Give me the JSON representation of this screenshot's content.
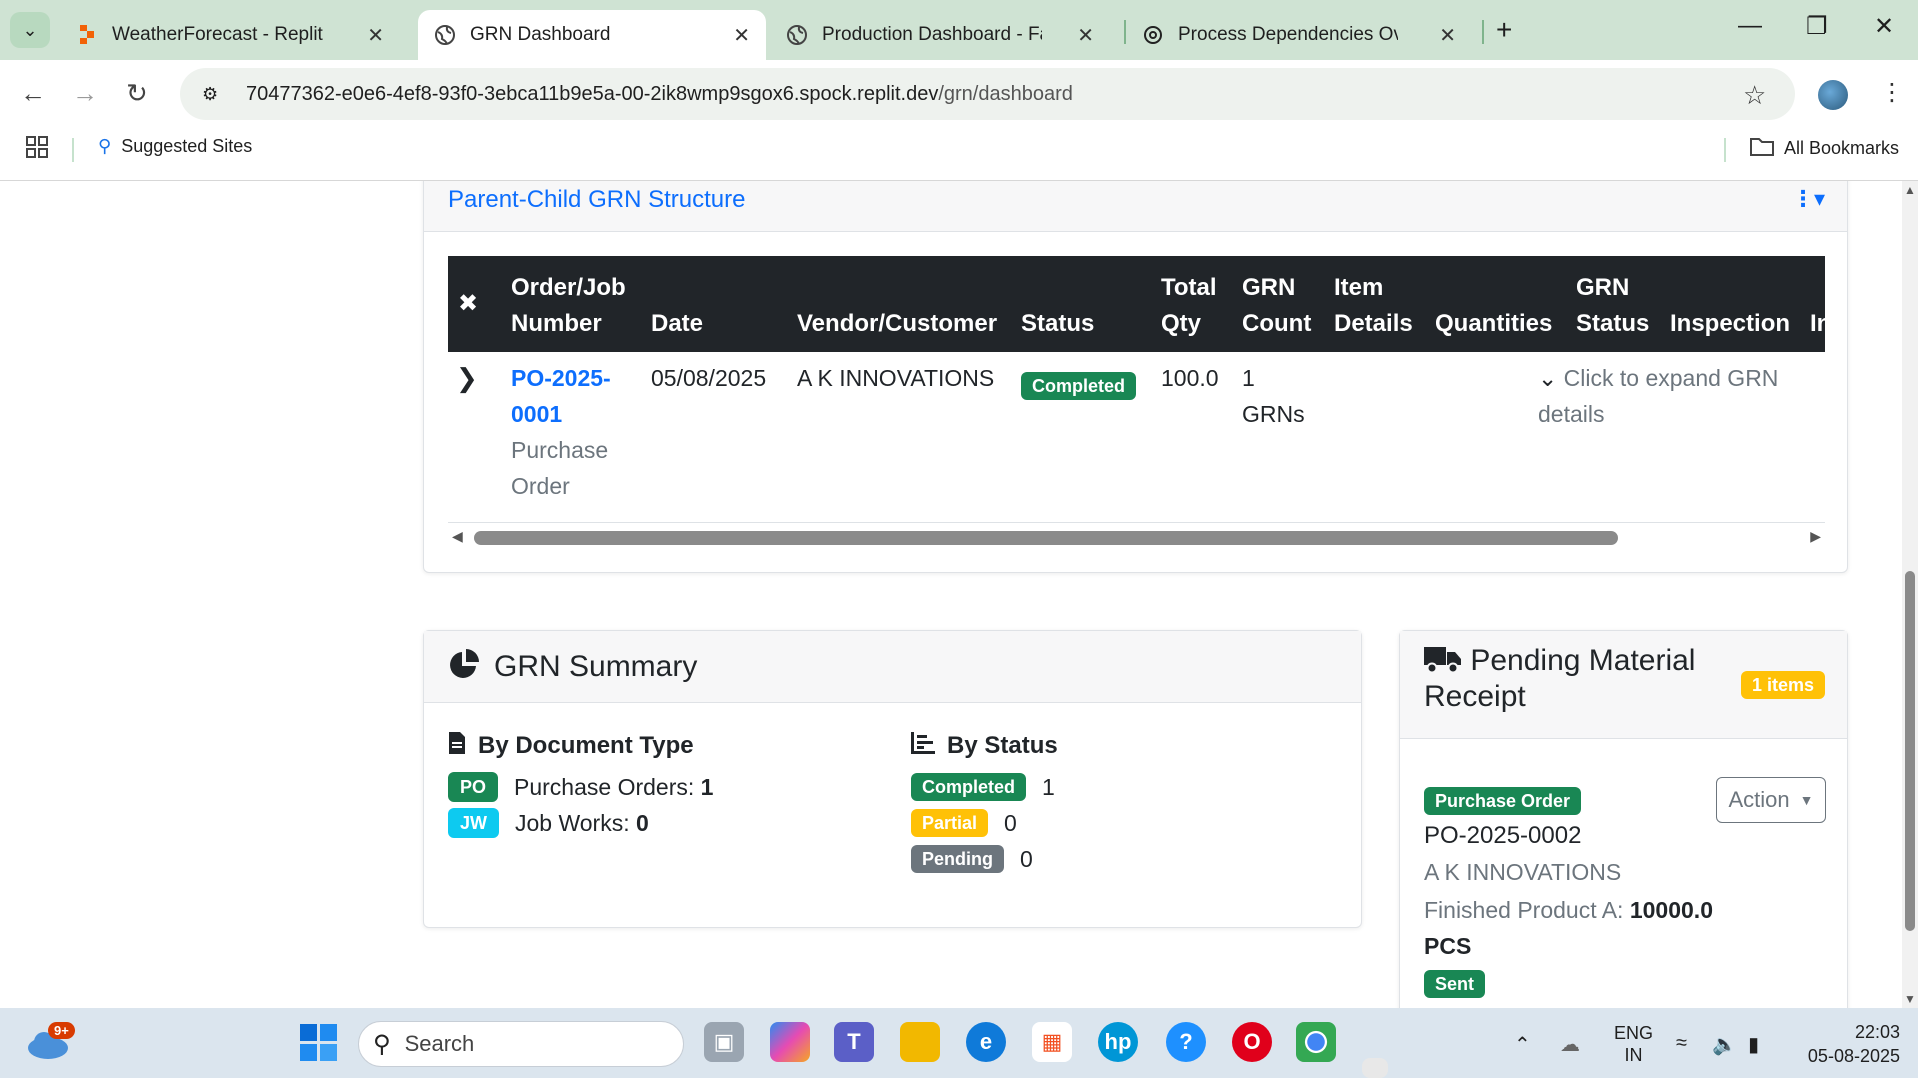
{
  "browser": {
    "tabs": [
      {
        "title": "WeatherForecast - Replit",
        "icon": "replit-icon"
      },
      {
        "title": "GRN Dashboard",
        "icon": "globe-icon"
      },
      {
        "title": "Production Dashboard - Factory",
        "icon": "globe-icon"
      },
      {
        "title": "Process Dependencies Overview",
        "icon": "chatgpt-icon"
      }
    ],
    "url_host": "70477362-e0e6-4ef8-93f0-3ebca11b9e5a-00-2ik8wmp9sgox6.spock.replit.dev",
    "url_path": "/grn/dashboard",
    "bookmarks": {
      "suggested": "Suggested Sites",
      "all": "All Bookmarks"
    }
  },
  "parent_child": {
    "title": "Parent-Child GRN Structure",
    "headers": {
      "order_l1": "Order/Job",
      "order_l2": "Number",
      "date": "Date",
      "vendor": "Vendor/Customer",
      "status": "Status",
      "qty_l1": "Total",
      "qty_l2": "Qty",
      "count_l1": "GRN",
      "count_l2": "Count",
      "item_l1": "Item",
      "item_l2": "Details",
      "quantities": "Quantities",
      "grnstatus_l1": "GRN",
      "grnstatus_l2": "Status",
      "inspection": "Inspection",
      "more": "In"
    },
    "row": {
      "order_l1": "PO-2025-",
      "order_l2": "0001",
      "doc_l1": "Purchase",
      "doc_l2": "Order",
      "date": "05/08/2025",
      "vendor": "A K INNOVATIONS",
      "status": "Completed",
      "qty": "100.0",
      "count_l1": "1",
      "count_l2": "GRNs",
      "expand": "Click to expand GRN details"
    }
  },
  "summary": {
    "title": "GRN Summary",
    "by_doc": "By Document Type",
    "po_badge": "PO",
    "po_label": "Purchase Orders:",
    "po_value": "1",
    "jw_badge": "JW",
    "jw_label": "Job Works:",
    "jw_value": "0",
    "by_status": "By Status",
    "completed": "Completed",
    "completed_value": "1",
    "partial": "Partial",
    "partial_value": "0",
    "pending": "Pending",
    "pending_value": "0"
  },
  "pending": {
    "title_l1": "Pending Material",
    "title_l2": "Receipt",
    "count_badge": "1 items",
    "doc_badge": "Purchase Order",
    "number": "PO-2025-0002",
    "vendor": "A K INNOVATIONS",
    "item_label": "Finished Product A:",
    "item_qty": "10000.0",
    "item_unit": "PCS",
    "state": "Sent",
    "action": "Action"
  },
  "taskbar": {
    "search": "Search",
    "weather_badge": "9+",
    "lang_l1": "ENG",
    "lang_l2": "IN",
    "time": "22:03",
    "date": "05-08-2025"
  },
  "colors": {
    "primary": "#0d6efd",
    "success": "#198754",
    "warning": "#ffc107",
    "secondary": "#6c757d",
    "info": "#0dcaf0",
    "dark": "#212529"
  }
}
